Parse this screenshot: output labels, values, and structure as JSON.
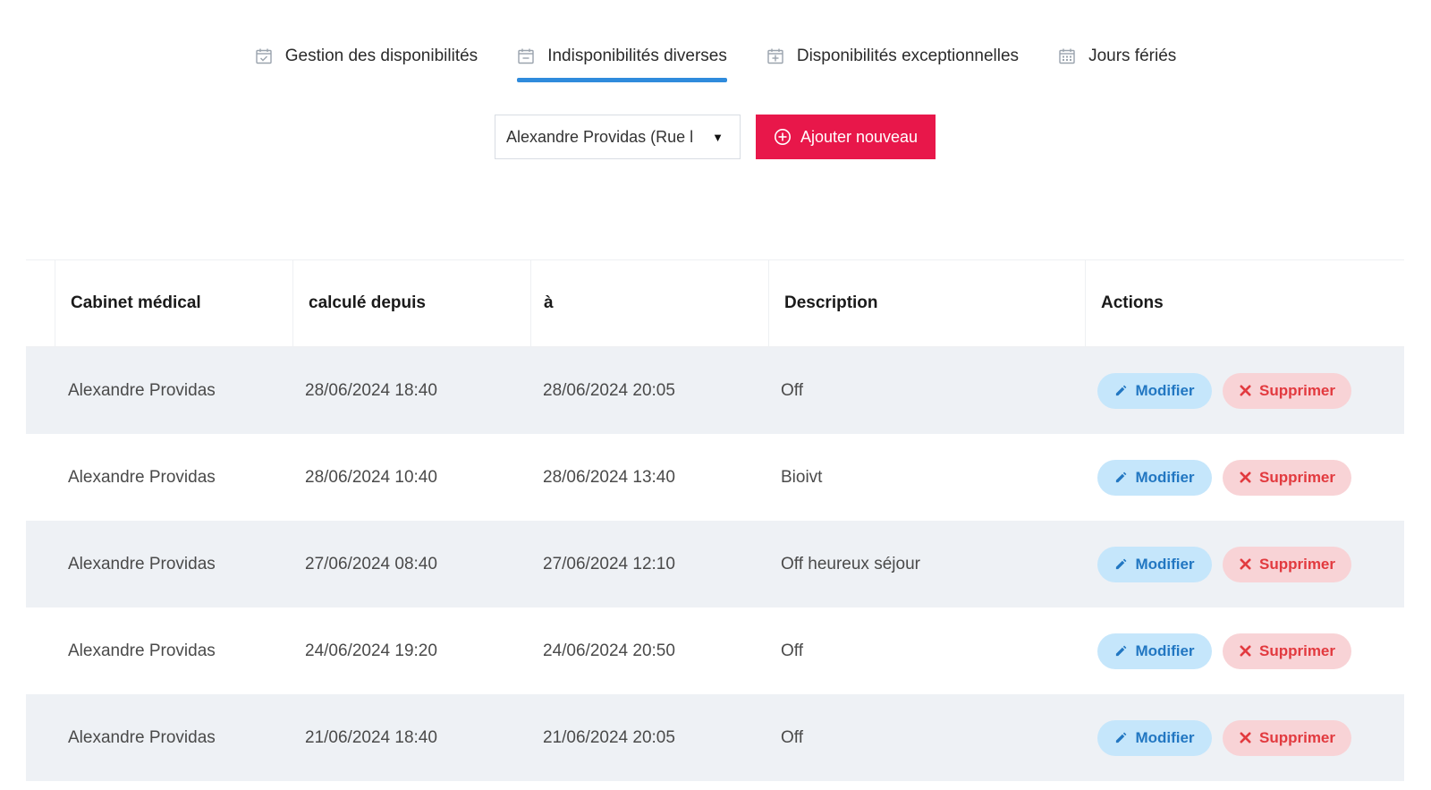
{
  "tabs": [
    {
      "label": "Gestion des disponibilités",
      "icon": "calendar-check-icon",
      "active": false
    },
    {
      "label": "Indisponibilités diverses",
      "icon": "calendar-minus-icon",
      "active": true
    },
    {
      "label": "Disponibilités exceptionnelles",
      "icon": "calendar-plus-icon",
      "active": false
    },
    {
      "label": "Jours fériés",
      "icon": "calendar-grid-icon",
      "active": false
    }
  ],
  "toolbar": {
    "select_value": "Alexandre Providas (Rue l",
    "add_label": "Ajouter nouveau"
  },
  "table": {
    "headers": [
      "Cabinet médical",
      "calculé depuis",
      "à",
      "Description",
      "Actions"
    ],
    "rows": [
      {
        "cabinet": "Alexandre Providas",
        "from": "28/06/2024 18:40",
        "to": "28/06/2024 20:05",
        "description": "Off"
      },
      {
        "cabinet": "Alexandre Providas",
        "from": "28/06/2024 10:40",
        "to": "28/06/2024 13:40",
        "description": "Bioivt"
      },
      {
        "cabinet": "Alexandre Providas",
        "from": "27/06/2024 08:40",
        "to": "27/06/2024 12:10",
        "description": "Off heureux séjour"
      },
      {
        "cabinet": "Alexandre Providas",
        "from": "24/06/2024 19:20",
        "to": "24/06/2024 20:50",
        "description": "Off"
      },
      {
        "cabinet": "Alexandre Providas",
        "from": "21/06/2024 18:40",
        "to": "21/06/2024 20:05",
        "description": "Off"
      }
    ],
    "edit_label": "Modifier",
    "delete_label": "Supprimer"
  },
  "colors": {
    "accent": "#2f8bdc",
    "add_button": "#e8174a",
    "edit_bg": "#c5e6fb",
    "edit_text": "#2277c2",
    "delete_bg": "#f8d3d6",
    "delete_text": "#e23a3f"
  }
}
